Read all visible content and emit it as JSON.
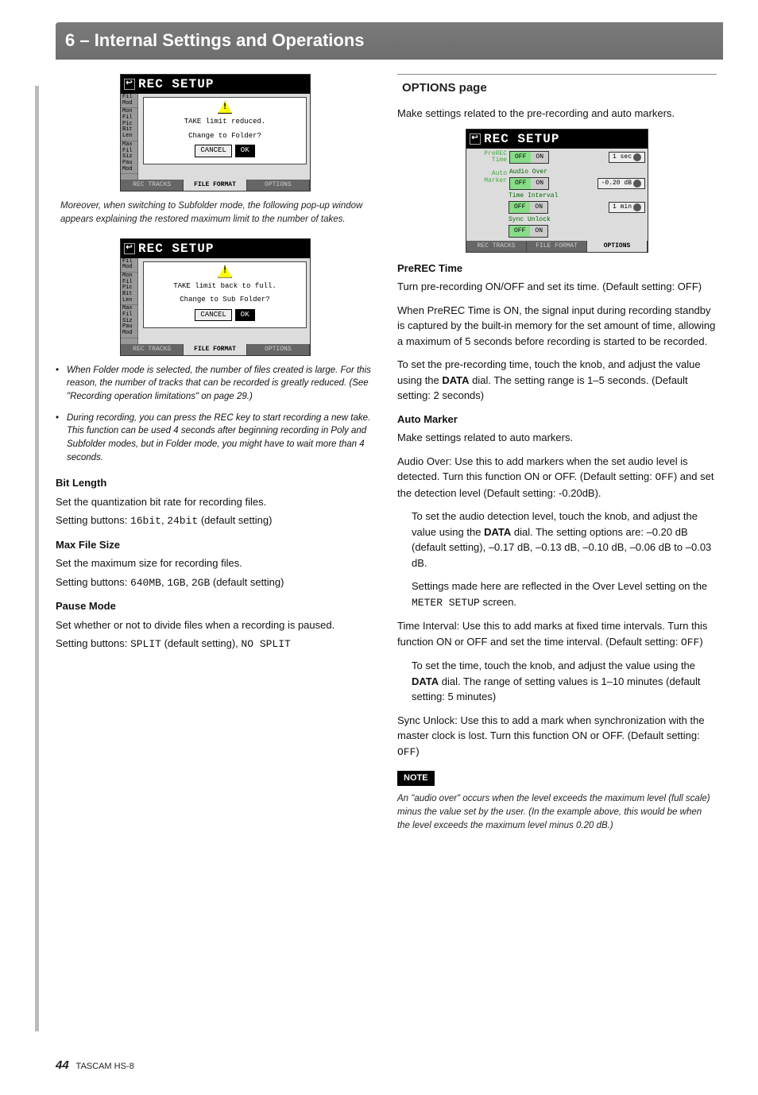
{
  "header": {
    "title": "6 – Internal Settings and Operations"
  },
  "left": {
    "shot1": {
      "title": "REC SETUP",
      "side": [
        "Fil\nMod",
        "Mon\nFil\nPic\nBit\nLen",
        "Max\nFil\nSiz\nPau\nMod"
      ],
      "msg1": "TAKE limit reduced.",
      "msg2": "Change to Folder?",
      "cancel": "CANCEL",
      "ok": "OK",
      "tabs": [
        "REC TRACKS",
        "FILE FORMAT",
        "OPTIONS"
      ],
      "tab_active": 1
    },
    "caption1": "Moreover, when switching to Subfolder mode, the following pop-up window appears explaining the restored maximum limit to the number of takes.",
    "shot2": {
      "title": "REC SETUP",
      "side": [
        "Fil\nMod",
        "Mon\nFil\nPic\nBit\nLen",
        "Max\nFil\nSiz\nPau\nMod"
      ],
      "msg1": "TAKE limit back to full.",
      "msg2": "Change to Sub Folder?",
      "cancel": "CANCEL",
      "ok": "OK",
      "tabs": [
        "REC TRACKS",
        "FILE FORMAT",
        "OPTIONS"
      ],
      "tab_active": 1
    },
    "bullets": [
      "When Folder mode is selected, the number of files created is large. For this reason, the number of tracks that can be recorded is greatly reduced. (See \"Recording operation limitations\" on page 29.)",
      "During recording, you can press the REC key to start recording a new take. This function can be used 4 seconds after beginning recording in Poly and Subfolder modes, but in Folder mode, you might have to wait more than 4 seconds."
    ],
    "bitlen_h": "Bit Length",
    "bitlen_p1": "Set the quantization bit rate for recording files.",
    "bitlen_p2a": "Setting buttons: ",
    "bitlen_p2b": "16bit",
    "bitlen_p2c": ", ",
    "bitlen_p2d": "24bit",
    "bitlen_p2e": " (default setting)",
    "maxfs_h": "Max File Size",
    "maxfs_p1": "Set the maximum size for recording files.",
    "maxfs_p2a": "Setting buttons: ",
    "maxfs_p2b": "640MB",
    "maxfs_p2c": ", ",
    "maxfs_p2d": "1GB",
    "maxfs_p2e": ", ",
    "maxfs_p2f": "2GB",
    "maxfs_p2g": " (default setting)",
    "pause_h": "Pause Mode",
    "pause_p1": "Set whether or not to divide files when a recording is paused.",
    "pause_p2a": "Setting buttons: ",
    "pause_p2b": "SPLIT",
    "pause_p2c": " (default setting), ",
    "pause_p2d": "NO SPLIT"
  },
  "right": {
    "section_h": "OPTIONS page",
    "intro": "Make settings related to the pre-recording and auto markers.",
    "shot": {
      "title": "REC SETUP",
      "rows": [
        {
          "lbl": "PreREC\nTime",
          "off": "OFF",
          "on": "ON",
          "val": "1 sec"
        },
        {
          "lbl": "Auto\nMarker",
          "sub": "Audio Over",
          "off": "OFF",
          "on": "ON",
          "val": "-0.20 dB"
        },
        {
          "sub": "Time Interval",
          "off": "OFF",
          "on": "ON",
          "val": "1 min"
        },
        {
          "sub": "Sync Unlock",
          "off": "OFF",
          "on": "ON"
        }
      ],
      "tabs": [
        "REC TRACKS",
        "FILE FORMAT",
        "OPTIONS"
      ],
      "tab_active": 2
    },
    "prerec_h": "PreREC Time",
    "prerec_p1": "Turn pre-recording ON/OFF and set its time. (Default setting: OFF)",
    "prerec_p2": "When PreREC Time is ON, the signal input during recording standby is captured by the built-in memory for the set amount of time, allowing a maximum of 5 seconds before recording is started to be recorded.",
    "prerec_p3a": "To set the pre-recording time, touch the knob, and adjust the value using the ",
    "prerec_p3b": "DATA",
    "prerec_p3c": " dial. The setting range is 1–5 seconds. (Default setting: 2 seconds)",
    "automark_h": "Auto Marker",
    "automark_intro": "Make settings related to auto markers.",
    "ao_p1a": "Audio Over: Use this to add markers when the set audio level is detected. Turn this function ON or OFF. (Default setting: ",
    "ao_p1b": "OFF",
    "ao_p1c": ") and set the detection level (Default setting: -0.20dB).",
    "ao_p2a": "To set the audio detection level, touch the knob, and adjust the value using the ",
    "ao_p2b": "DATA",
    "ao_p2c": " dial. The setting options are: –0.20 dB (default setting), –0.17 dB, –0.13 dB, –0.10 dB, –0.06 dB to –0.03 dB.",
    "ao_p3a": "Settings made here are reflected in the Over Level setting on the ",
    "ao_p3b": "METER SETUP",
    "ao_p3c": " screen.",
    "ti_p1a": "Time Interval: Use this to add marks at fixed time intervals. Turn this function ON or OFF and set the time interval. (Default setting: ",
    "ti_p1b": "OFF",
    "ti_p1c": ")",
    "ti_p2a": "To set the time, touch the knob, and adjust the value using the ",
    "ti_p2b": "DATA",
    "ti_p2c": " dial. The range of setting values is 1–10 minutes (default setting: 5 minutes)",
    "su_p1a": "Sync Unlock: Use this to add a mark when synchronization with the master clock is lost. Turn this function ON or OFF. (Default setting: ",
    "su_p1b": "OFF",
    "su_p1c": ")",
    "note_tag": "NOTE",
    "note_body": "An \"audio over\" occurs when the level exceeds the maximum level (full scale) minus the value set by the user. (In the example above, this would be when the level exceeds the maximum level minus 0.20 dB.)"
  },
  "footer": {
    "page": "44",
    "model": "TASCAM HS-8"
  }
}
